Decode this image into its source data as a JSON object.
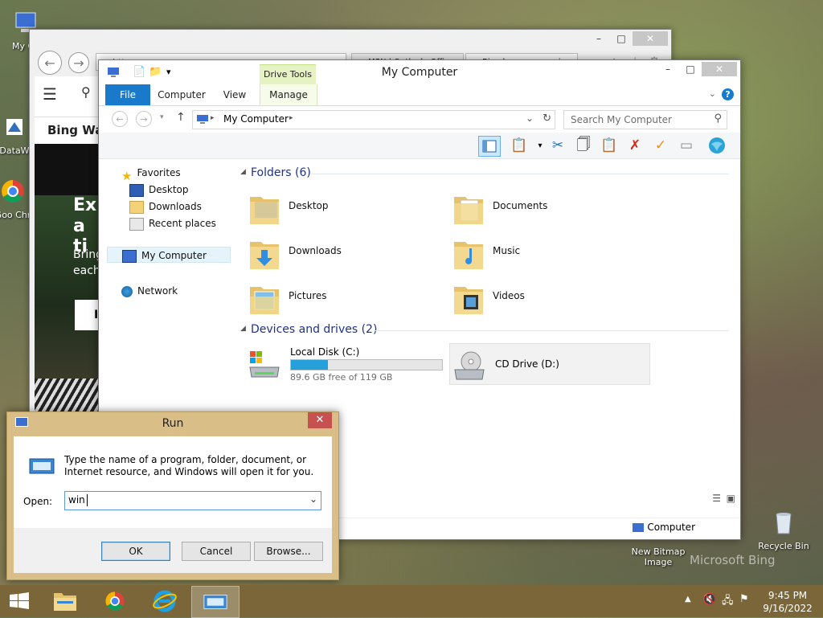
{
  "desktop": {
    "icons": [
      {
        "label": "My Co"
      },
      {
        "label": "DataW"
      },
      {
        "label": "Goo Chr"
      },
      {
        "label": "New Bitmap Image"
      },
      {
        "label": "Recycle Bin"
      }
    ],
    "watermark": "Microsoft Bing"
  },
  "browser": {
    "url_partial": "http",
    "tab1": "MSN | Outlook, Offi...",
    "tab2": "Bing homepage quiz...",
    "menu_label": "☰",
    "page_heading": "Bing Wal",
    "promo_line1": "Exp",
    "promo_line2": "a ti",
    "promo_body1": "Bring",
    "promo_body2": "each",
    "promo_button": "I"
  },
  "explorer": {
    "title": "My Computer",
    "context_tab": "Drive Tools",
    "tabs": {
      "file": "File",
      "computer": "Computer",
      "view": "View",
      "manage": "Manage"
    },
    "address": "My Computer",
    "search_placeholder": "Search My Computer",
    "nav": {
      "favorites": "Favorites",
      "desktop": "Desktop",
      "downloads": "Downloads",
      "recent": "Recent places",
      "computer": "My Computer",
      "network": "Network"
    },
    "folders_header": "Folders (6)",
    "folders": [
      "Desktop",
      "Documents",
      "Downloads",
      "Music",
      "Pictures",
      "Videos"
    ],
    "drives_header": "Devices and drives (2)",
    "drives": [
      {
        "name": "Local Disk (C:)",
        "free": "89.6 GB free of 119 GB",
        "used_fraction": 0.247
      },
      {
        "name": "CD Drive (D:)"
      }
    ],
    "status_location": "Computer"
  },
  "run": {
    "title": "Run",
    "description": "Type the name of a program, folder, document, or Internet resource, and Windows will open it for you.",
    "open_label": "Open:",
    "open_value": "win",
    "ok": "OK",
    "cancel": "Cancel",
    "browse": "Browse..."
  },
  "taskbar": {
    "time": "9:45 PM",
    "date": "9/16/2022"
  },
  "colors": {
    "accent": "#1979ca",
    "taskbar": "#7a6638",
    "run_frame": "#d9bf87",
    "drive_bar": "#26a0da"
  }
}
